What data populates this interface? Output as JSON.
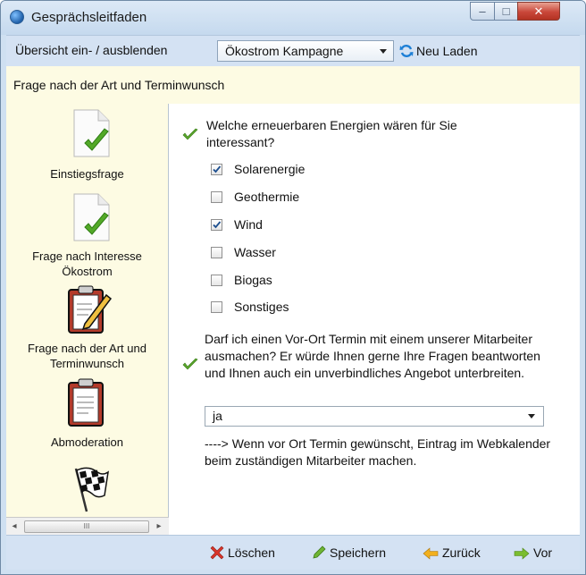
{
  "window": {
    "title": "Gesprächsleitfaden",
    "controls": {
      "minimize": "‒",
      "maximize": "□",
      "close": "✕"
    }
  },
  "toolbar": {
    "toggle_label": "Übersicht ein- / ausblenden",
    "campaign_selected": "Ökostrom Kampagne",
    "reload_label": "Neu Laden"
  },
  "section": {
    "title": "Frage nach der Art und Terminwunsch"
  },
  "steps": [
    {
      "label": "Einstiegsfrage",
      "icon": "document-check-icon"
    },
    {
      "label": "Frage nach Interesse Ökostrom",
      "icon": "document-check-icon"
    },
    {
      "label": "Frage nach der Art und Terminwunsch",
      "icon": "clipboard-pencil-icon"
    },
    {
      "label": "Abmoderation",
      "icon": "clipboard-icon"
    },
    {
      "label": "",
      "icon": "checkered-flag-icon"
    }
  ],
  "scrollbar": {
    "left": "◂",
    "right": "▸",
    "grip": "III"
  },
  "question1": {
    "text": "Welche erneuerbaren Energien wären für Sie interessant?",
    "options": [
      {
        "label": "Solarenergie",
        "checked": true
      },
      {
        "label": "Geothermie",
        "checked": false
      },
      {
        "label": "Wind",
        "checked": true
      },
      {
        "label": "Wasser",
        "checked": false
      },
      {
        "label": "Biogas",
        "checked": false
      },
      {
        "label": "Sonstiges",
        "checked": false
      }
    ]
  },
  "question2": {
    "text": "Darf ich einen Vor-Ort Termin mit einem unserer Mitarbeiter ausmachen? Er würde Ihnen gerne Ihre Fragen beantworten und Ihnen auch ein unverbindliches Angebot unterbreiten.",
    "answer": "ja",
    "hint": "----> Wenn vor Ort Termin gewünscht, Eintrag im Webkalender beim zuständigen Mitarbeiter machen."
  },
  "footer": {
    "delete_label": "Löschen",
    "save_label": "Speichern",
    "back_label": "Zurück",
    "next_label": "Vor"
  },
  "colors": {
    "accent_green": "#5aa52b",
    "delete_red": "#d9352a",
    "panel_yellow": "#fdfbe3",
    "chrome_blue": "#d4e2f3"
  }
}
